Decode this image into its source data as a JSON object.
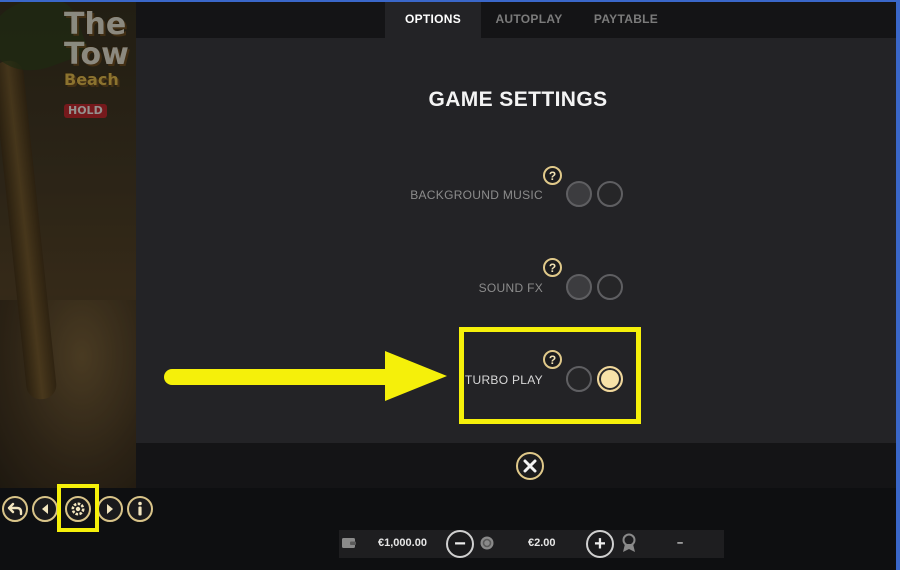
{
  "game": {
    "logo_line1": "The",
    "logo_line2": "Tow",
    "logo_line3": "Beach",
    "logo_badge": "HOLD"
  },
  "tabs": [
    {
      "label": "OPTIONS",
      "active": true
    },
    {
      "label": "AUTOPLAY",
      "active": false
    },
    {
      "label": "PAYTABLE",
      "active": false
    }
  ],
  "panel": {
    "title": "GAME SETTINGS",
    "settings": [
      {
        "label": "BACKGROUND MUSIC",
        "help": "?",
        "selected": "none"
      },
      {
        "label": "SOUND FX",
        "help": "?",
        "selected": "none"
      },
      {
        "label": "TURBO PLAY",
        "help": "?",
        "selected": "on"
      }
    ]
  },
  "bottom": {
    "balance": "€1,000.00",
    "bet": "€2.00",
    "minus": "−",
    "plus": "+",
    "win": "–"
  },
  "colors": {
    "panel_bg": "#232326",
    "accent_gold": "#e0c98a",
    "highlight_yellow": "#f5f00a",
    "toggle_on": "#f7e2a8"
  }
}
